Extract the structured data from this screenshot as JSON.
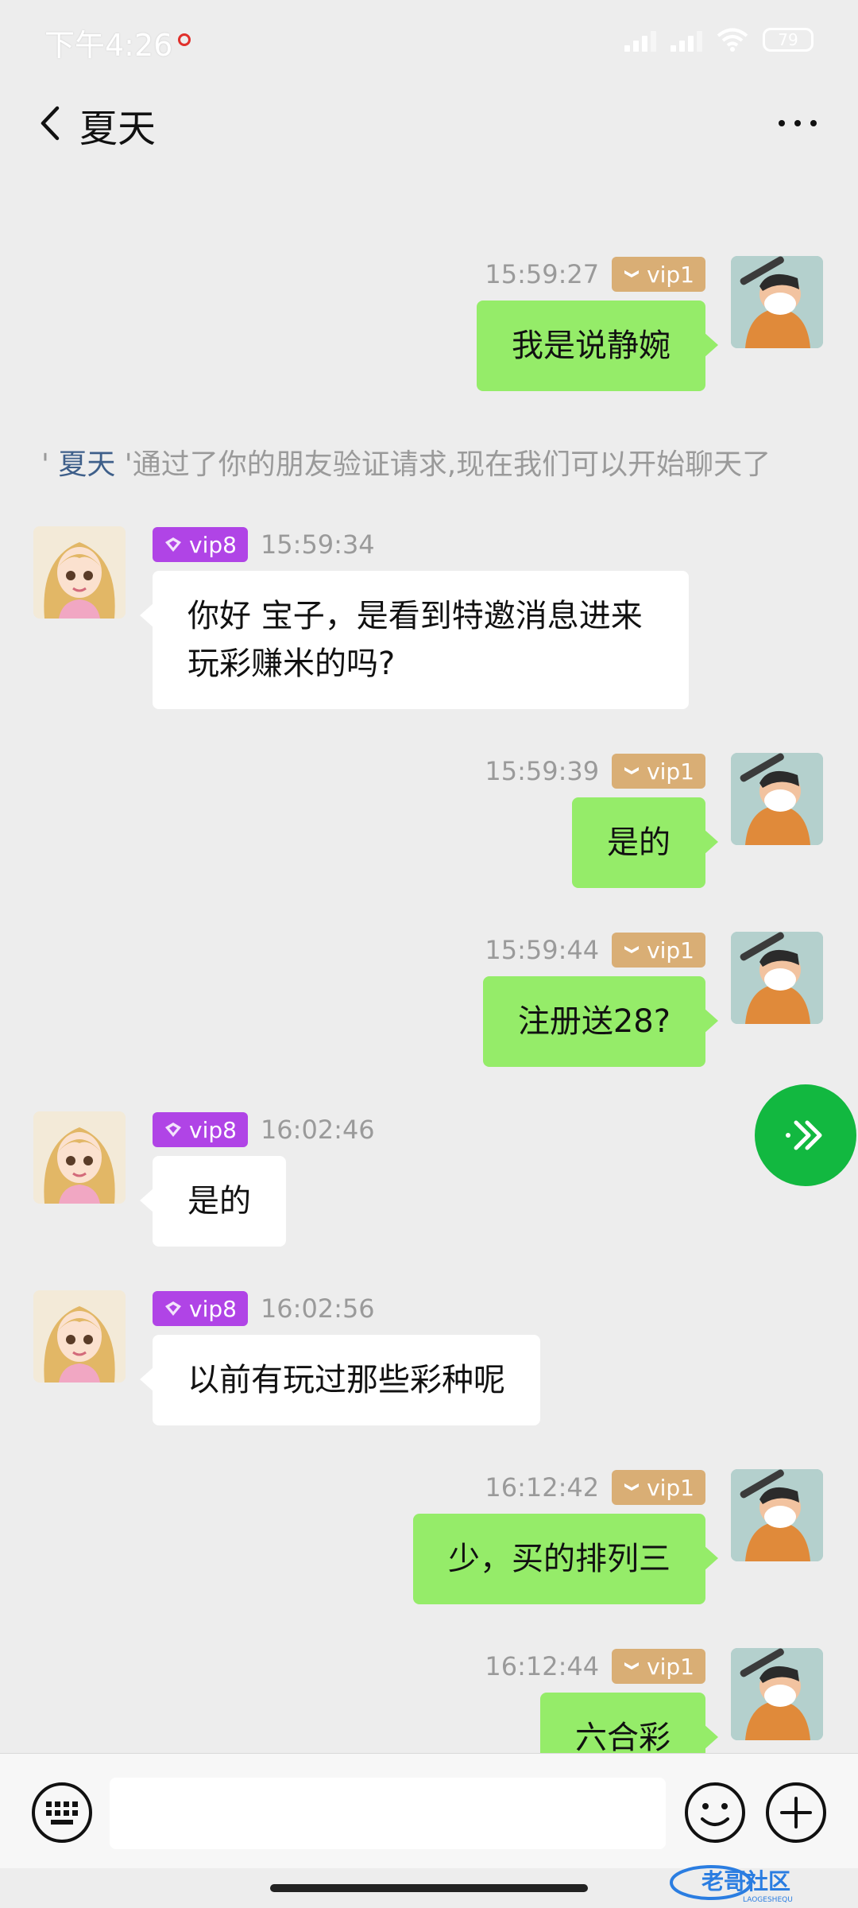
{
  "status_bar": {
    "time": "下午4:26",
    "battery": "79"
  },
  "header": {
    "title": "夏天"
  },
  "system_message": {
    "prefix": "' ",
    "name": "夏天",
    "text": " '通过了你的朋友验证请求,现在我们可以开始聊天了"
  },
  "messages": [
    {
      "side": "me",
      "time": "15:59:27",
      "vip": "vip1",
      "text": "我是说静婉"
    },
    {
      "side": "them",
      "time": "15:59:34",
      "vip": "vip8",
      "text": "你好 宝子，是看到特邀消息进来玩彩赚米的吗?"
    },
    {
      "side": "me",
      "time": "15:59:39",
      "vip": "vip1",
      "text": "是的"
    },
    {
      "side": "me",
      "time": "15:59:44",
      "vip": "vip1",
      "text": "注册送28?"
    },
    {
      "side": "them",
      "time": "16:02:46",
      "vip": "vip8",
      "text": "是的"
    },
    {
      "side": "them",
      "time": "16:02:56",
      "vip": "vip8",
      "text": "以前有玩过那些彩种呢"
    },
    {
      "side": "me",
      "time": "16:12:42",
      "vip": "vip1",
      "text": "少，买的排列三"
    },
    {
      "side": "me",
      "time": "16:12:44",
      "vip": "vip1",
      "text": "六合彩"
    }
  ],
  "input": {
    "value": "",
    "placeholder": ""
  },
  "watermark": {
    "text": "老哥社区",
    "sub": "LAOGESHEQU"
  },
  "colors": {
    "me_bubble": "#95ec69",
    "them_bubble": "#ffffff",
    "vip1": "#d9ae75",
    "vip8": "#b044e6",
    "fab": "#12b840"
  },
  "icons": [
    "back-icon",
    "more-icon",
    "keyboard-icon",
    "emoji-icon",
    "plus-icon",
    "double-chevron-icon",
    "vip-badge-icon"
  ]
}
